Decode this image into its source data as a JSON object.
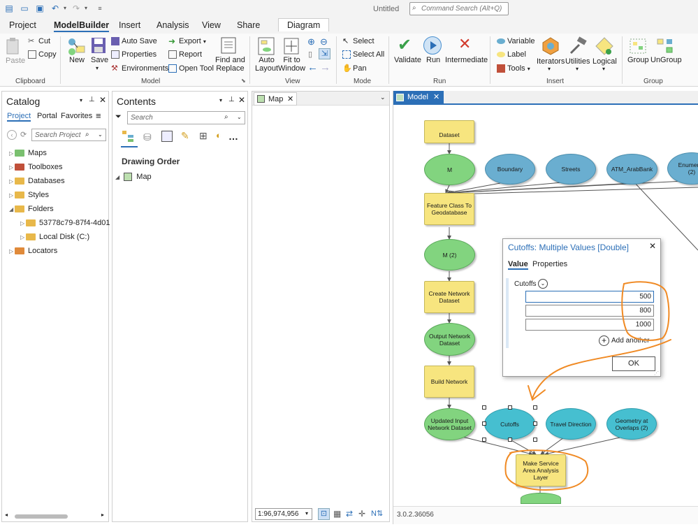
{
  "app": {
    "title": "Untitled",
    "command_search_placeholder": "Command Search (Alt+Q)"
  },
  "tabs": [
    "Project",
    "ModelBuilder",
    "Insert",
    "Analysis",
    "View",
    "Share",
    "Diagram"
  ],
  "ribbon": {
    "clipboard": {
      "paste": "Paste",
      "cut": "Cut",
      "copy": "Copy",
      "group": "Clipboard"
    },
    "model": {
      "new": "New",
      "save": "Save",
      "auto_save": "Auto Save",
      "properties": "Properties",
      "environments": "Environments",
      "export": "Export",
      "report": "Report",
      "open_tool": "Open Tool",
      "find_replace_1": "Find and",
      "find_replace_2": "Replace",
      "group": "Model"
    },
    "view": {
      "auto_layout_1": "Auto",
      "auto_layout_2": "Layout",
      "fit_1": "Fit to",
      "fit_2": "Window",
      "group": "View"
    },
    "mode": {
      "select": "Select",
      "select_all": "Select All",
      "pan": "Pan",
      "group": "Mode"
    },
    "run": {
      "validate": "Validate",
      "run": "Run",
      "intermediate": "Intermediate",
      "group": "Run"
    },
    "insert": {
      "variable": "Variable",
      "label": "Label",
      "tools": "Tools",
      "iterators": "Iterators",
      "utilities": "Utilities",
      "logical": "Logical",
      "group": "Insert"
    },
    "groupg": {
      "group": "Group",
      "ungroup": "UnGroup",
      "group_label": "Group"
    }
  },
  "catalog": {
    "title": "Catalog",
    "tabs": [
      "Project",
      "Portal",
      "Favorites"
    ],
    "search_placeholder": "Search Project",
    "items": [
      "Maps",
      "Toolboxes",
      "Databases",
      "Styles",
      "Folders",
      "53778c79-87f4-4d01",
      "Local Disk (C:)",
      "Locators"
    ]
  },
  "contents": {
    "title": "Contents",
    "search_placeholder": "Search",
    "drawing_order": "Drawing Order",
    "map_item": "Map"
  },
  "map_tab": {
    "label": "Map",
    "scale": "1:96,974,956"
  },
  "model_tab": {
    "label": "Model",
    "version": "3.0.2.36056"
  },
  "nodes": {
    "dataset": "Dataset",
    "m": "M",
    "boundary": "Boundary",
    "streets": "Streets",
    "atm": "ATM_ArabBank",
    "enum_1": "Enumerati",
    "enum_2": "(2)",
    "fc_1": "Feature Class To",
    "fc_2": "Geodatabase",
    "m2": "M (2)",
    "cnd_1": "Create Network",
    "cnd_2": "Dataset",
    "ond_1": "Output Network",
    "ond_2": "Dataset",
    "build": "Build Network",
    "uind_1": "Updated Input",
    "uind_2": "Network Dataset",
    "cutoffs": "Cutoffs",
    "travel": "Travel Direction",
    "geo_1": "Geometry at",
    "geo_2": "Overlaps (2)",
    "msa_1": "Make Service",
    "msa_2": "Area Analysis",
    "msa_3": "Layer"
  },
  "dialog": {
    "title": "Cutoffs: Multiple Values [Double]",
    "tab_value": "Value",
    "tab_properties": "Properties",
    "label": "Cutoffs",
    "values": [
      "500",
      "800",
      "1000"
    ],
    "add_another": "Add another",
    "ok": "OK"
  },
  "colors": {
    "accent": "#2c6fb7",
    "annotation": "#f08a24"
  }
}
